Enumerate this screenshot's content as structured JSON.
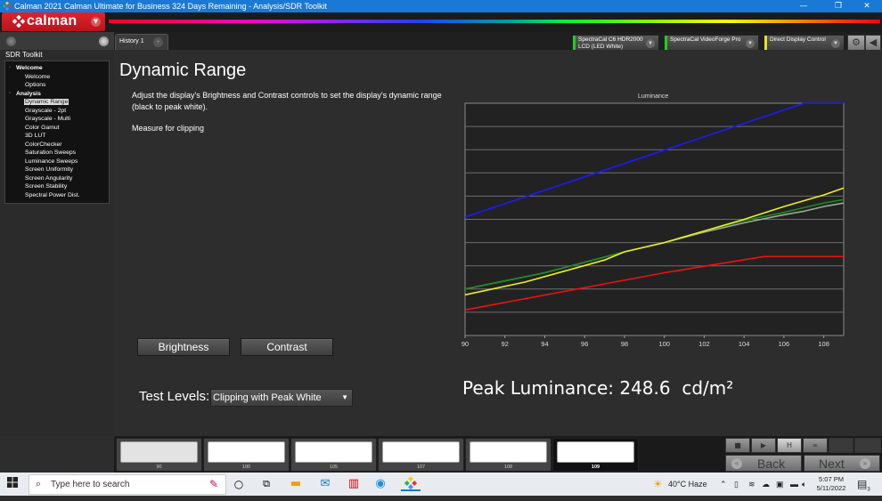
{
  "window": {
    "title": "Calman 2021 Calman Ultimate for Business 324 Days Remaining  - Analysis/SDR Toolkit",
    "minimize": "—",
    "maximize": "❐",
    "close": "✕"
  },
  "app": {
    "logo_text": "calman",
    "rainbow_colors": [
      "#ff0020",
      "#ff00c0",
      "#2040ff",
      "#00ff30",
      "#ffff00",
      "#ff4a00"
    ]
  },
  "sidebar": {
    "title": "SDR Toolkit",
    "groups": [
      {
        "label": "Welcome",
        "items": [
          "Welcome",
          "Options"
        ]
      },
      {
        "label": "Analysis",
        "items": [
          "Dynamic Range",
          "Grayscale - 2pt",
          "Grayscale - Multi",
          "Color Gamut",
          "3D LUT",
          "ColorChecker",
          "Saturation Sweeps",
          "Luminance Sweeps",
          "Screen Uniformity",
          "Screen Angularity",
          "Screen Stability",
          "Spectral Power Dist."
        ]
      }
    ],
    "selected": "Dynamic Range"
  },
  "tabs": [
    {
      "label": "History 1"
    }
  ],
  "devices": [
    {
      "line1": "SpectraCal C6 HDR2000",
      "line2": "LCD (LED White)",
      "color": "#22cc22"
    },
    {
      "line1": "SpectraCal VideoForge Pro",
      "line2": "",
      "color": "#22cc22"
    },
    {
      "line1": "Direct Display Control",
      "line2": "",
      "color": "#e8e020"
    }
  ],
  "main": {
    "title": "Dynamic Range",
    "description": "Adjust the display's Brightness and Contrast controls to set the display's dynamic range (black to peak white).",
    "measure_text": "Measure for clipping",
    "brightness_label": "Brightness",
    "contrast_label": "Contrast",
    "test_levels_label": "Test Levels:",
    "test_levels_value": "Clipping with Peak White",
    "peak_luminance": "Peak Luminance: 248.6  cd/m²"
  },
  "chart_data": {
    "type": "line",
    "title": "Luminance",
    "xlabel": "",
    "ylabel": "",
    "x_ticks": [
      90,
      92,
      94,
      96,
      98,
      100,
      102,
      104,
      106,
      108
    ],
    "xlim": [
      90,
      109
    ],
    "ylim": [
      0,
      10
    ],
    "grid": true,
    "y_units_note": "relative gridline units (no y tick labels shown)",
    "series": [
      {
        "name": "Blue",
        "color": "#1a1aff",
        "x": [
          90,
          107,
          109
        ],
        "y": [
          5.1,
          10.0,
          10.0
        ]
      },
      {
        "name": "Gray (Y)",
        "color": "#9aaa9a",
        "x": [
          90,
          94,
          98,
          100,
          102,
          104,
          106,
          107,
          108,
          109
        ],
        "y": [
          2.0,
          2.7,
          3.6,
          4.0,
          4.45,
          4.85,
          5.2,
          5.35,
          5.55,
          5.7
        ]
      },
      {
        "name": "Green",
        "color": "#1c8a1c",
        "x": [
          90,
          94,
          98,
          100,
          102,
          104,
          106,
          107,
          108,
          109
        ],
        "y": [
          2.0,
          2.7,
          3.6,
          4.0,
          4.5,
          4.95,
          5.3,
          5.5,
          5.7,
          5.85
        ]
      },
      {
        "name": "Yellow",
        "color": "#f0f020",
        "x": [
          90,
          93,
          97,
          98,
          100,
          102,
          104,
          106,
          108,
          109
        ],
        "y": [
          1.75,
          2.3,
          3.25,
          3.6,
          4.0,
          4.5,
          5.0,
          5.55,
          6.05,
          6.35
        ]
      },
      {
        "name": "Red",
        "color": "#ee1111",
        "x": [
          90,
          95,
          100,
          105,
          109
        ],
        "y": [
          1.1,
          1.9,
          2.7,
          3.4,
          3.4
        ]
      }
    ]
  },
  "swatches": [
    {
      "label": "90",
      "color": "#e3e3e3",
      "active": false
    },
    {
      "label": "100",
      "color": "#ffffff",
      "active": false
    },
    {
      "label": "105",
      "color": "#ffffff",
      "active": false
    },
    {
      "label": "107",
      "color": "#ffffff",
      "active": false
    },
    {
      "label": "108",
      "color": "#ffffff",
      "active": false
    },
    {
      "label": "109",
      "color": "#ffffff",
      "active": true
    }
  ],
  "controls": {
    "stop": "■",
    "play": "▶",
    "hold": "H",
    "loop": "∞",
    "back_label": "Back",
    "next_label": "Next"
  },
  "taskbar": {
    "search_placeholder": "Type here to search",
    "weather": "40°C  Haze",
    "time": "5:07 PM",
    "date": "5/11/2022",
    "notifications": "3"
  }
}
